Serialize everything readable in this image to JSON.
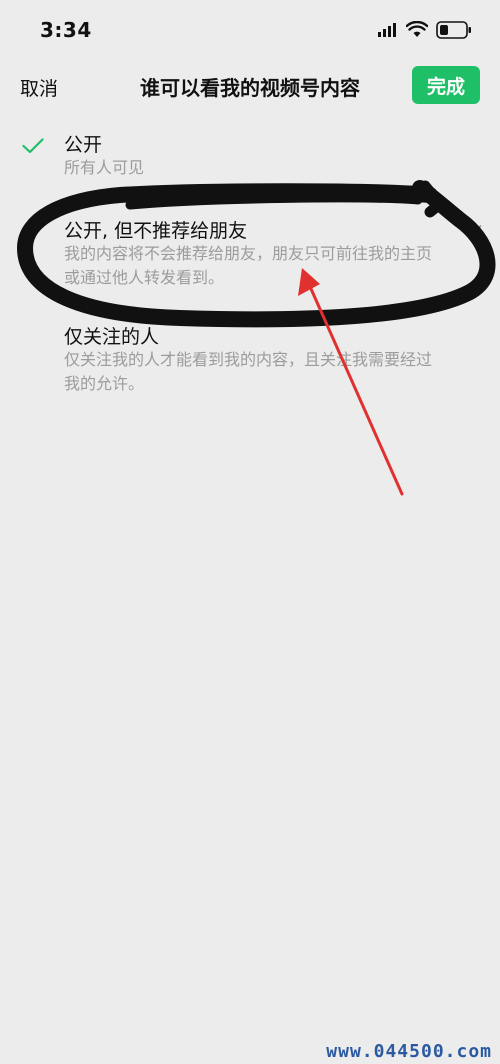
{
  "status_bar": {
    "time": "3:34",
    "icons": [
      "signal-icon",
      "wifi-icon",
      "battery-icon"
    ]
  },
  "nav": {
    "cancel_label": "取消",
    "title": "谁可以看我的视频号内容",
    "done_label": "完成"
  },
  "options": [
    {
      "title": "公开",
      "desc": "所有人可见",
      "selected": true
    },
    {
      "title": "公开, 但不推荐给朋友",
      "desc": "我的内容将不会推荐给朋友，朋友只可前往我的主页或通过他人转发看到。",
      "selected": false
    },
    {
      "title": "仅关注的人",
      "desc": "仅关注我的人才能看到我的内容，且关注我需要经过我的允许。",
      "selected": false
    }
  ],
  "watermark": "www.044500.com",
  "colors": {
    "background": "#ececec",
    "accent": "#1fbf67",
    "title": "#111111",
    "desc": "#9c9c9c",
    "annotation_stroke": "#111111",
    "annotation_arrow": "#e0302f",
    "watermark": "#2c5aa0"
  }
}
